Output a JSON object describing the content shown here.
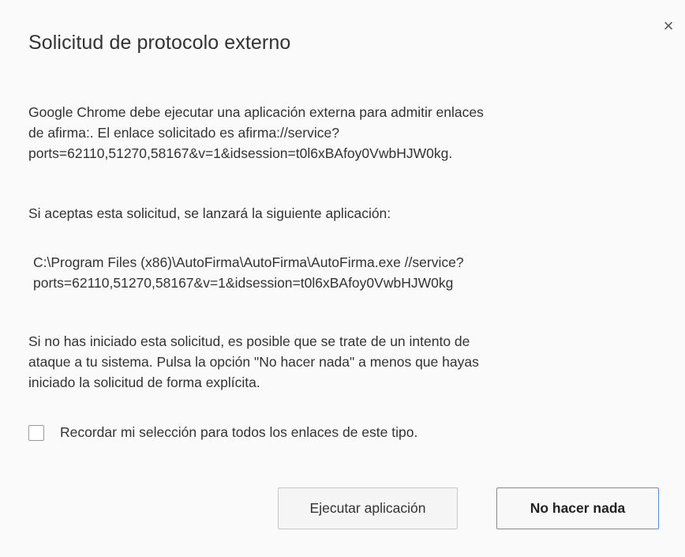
{
  "dialog": {
    "title": "Solicitud de protocolo externo",
    "close_glyph": "×",
    "paragraph1_line1": "Google Chrome debe ejecutar una aplicación externa para admitir enlaces",
    "paragraph1_line2": "de afirma:. El enlace solicitado es afirma://service?",
    "paragraph1_line3": "ports=62110,51270,58167&v=1&idsession=t0l6xBAfoy0VwbHJW0kg.",
    "paragraph2": "Si aceptas esta solicitud, se lanzará la siguiente aplicación:",
    "paragraph3_line1": "C:\\Program Files (x86)\\AutoFirma\\AutoFirma\\AutoFirma.exe //service?",
    "paragraph3_line2": "ports=62110,51270,58167&v=1&idsession=t0l6xBAfoy0VwbHJW0kg",
    "paragraph4_line1": "Si no has iniciado esta solicitud, es posible que se trate de un intento de",
    "paragraph4_line2": "ataque a tu sistema. Pulsa la opción \"No hacer nada\" a menos que hayas",
    "paragraph4_line3": "iniciado la solicitud de forma explícita.",
    "checkbox_label": "Recordar mi selección para todos los enlaces de este tipo.",
    "checkbox_checked": false,
    "execute_button_label": "Ejecutar aplicación",
    "do_nothing_button_label": "No hacer nada",
    "focus_color": "#4d90fe"
  }
}
